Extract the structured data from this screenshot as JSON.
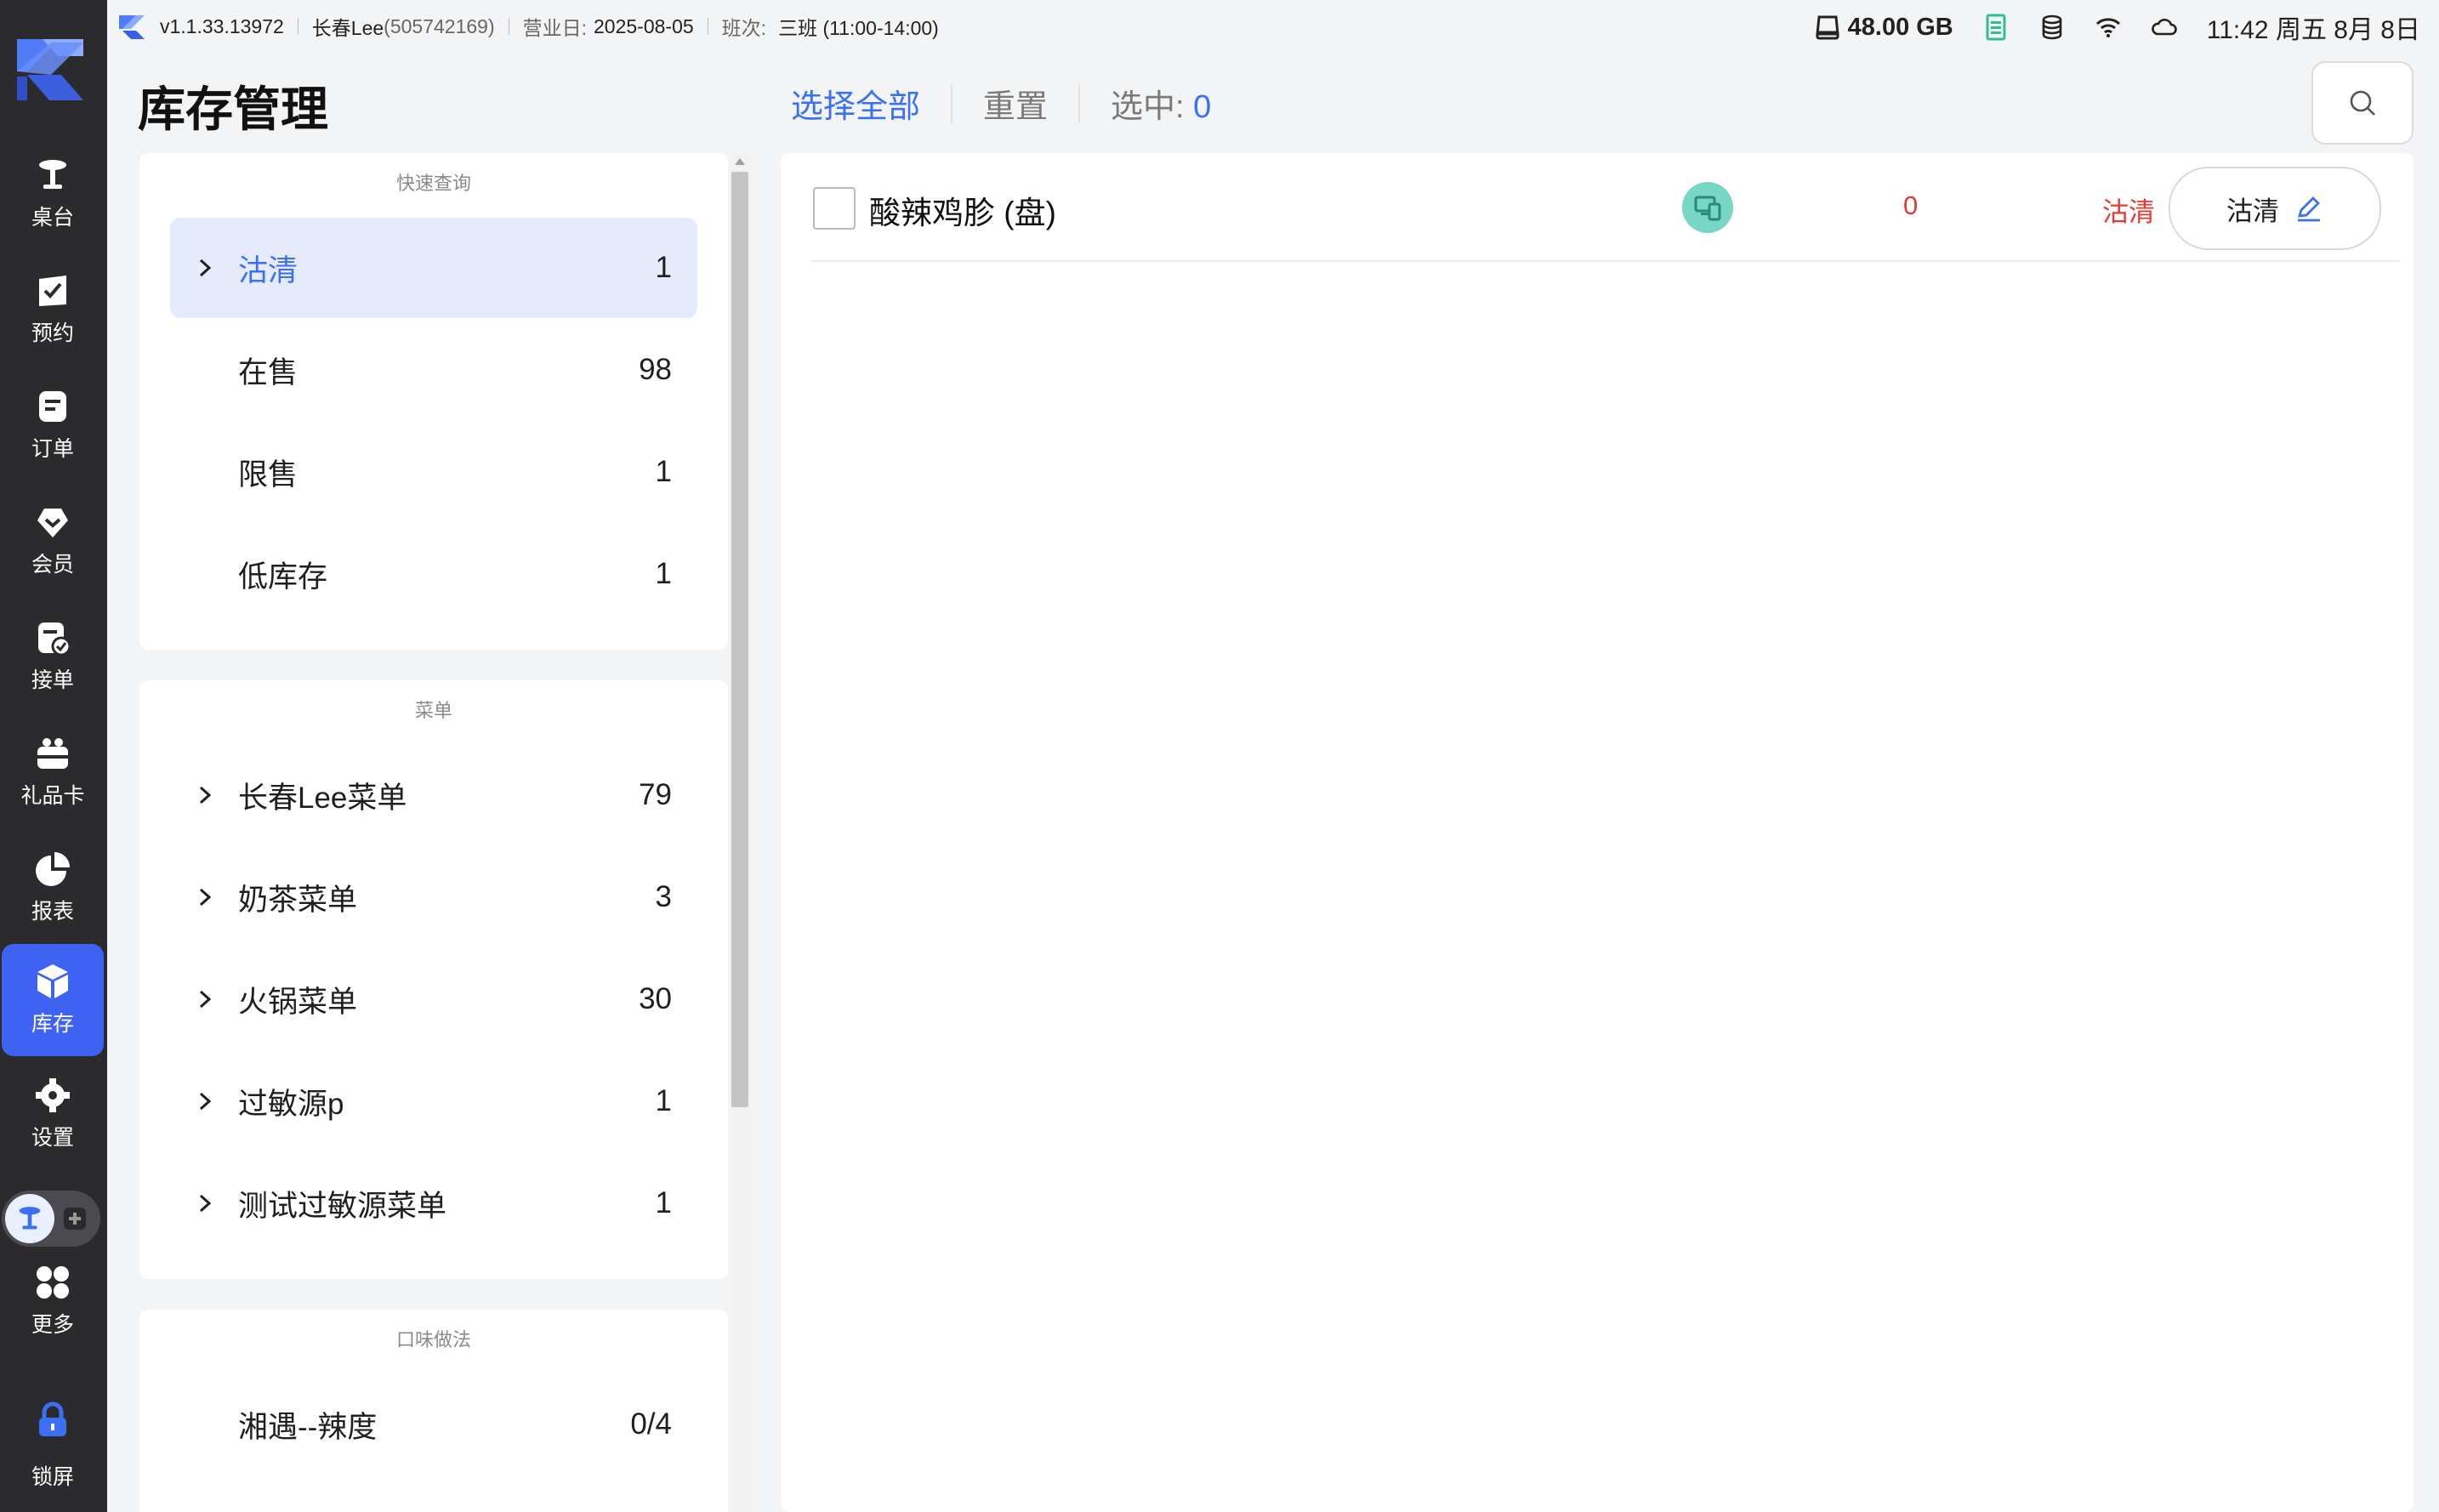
{
  "app": {
    "version": "v1.1.33.13972",
    "store": "长春Lee",
    "store_id": "(505742169)",
    "business_day_label": "营业日:",
    "business_day": "2025-08-05",
    "shift_label": "班次:",
    "shift": "三班 (11:00-14:00)"
  },
  "status": {
    "disk": "48.00 GB",
    "time": "11:42 周五 8月 8日"
  },
  "nav": {
    "items": [
      {
        "label": "桌台",
        "icon": "table-icon"
      },
      {
        "label": "预约",
        "icon": "reservation-icon"
      },
      {
        "label": "订单",
        "icon": "order-icon"
      },
      {
        "label": "会员",
        "icon": "member-icon"
      },
      {
        "label": "接单",
        "icon": "accept-order-icon"
      },
      {
        "label": "礼品卡",
        "icon": "gift-card-icon"
      },
      {
        "label": "报表",
        "icon": "report-icon"
      },
      {
        "label": "库存",
        "icon": "inventory-icon"
      },
      {
        "label": "设置",
        "icon": "settings-icon"
      },
      {
        "label": "更多",
        "icon": "more-icon"
      },
      {
        "label": "锁屏",
        "icon": "lock-icon"
      }
    ],
    "active": "库存"
  },
  "header": {
    "title": "库存管理",
    "select_all": "选择全部",
    "reset": "重置",
    "selected_label": "选中:",
    "selected_count": "0"
  },
  "filters": {
    "quick": {
      "title": "快速查询",
      "items": [
        {
          "label": "沽清",
          "count": "1"
        },
        {
          "label": "在售",
          "count": "98"
        },
        {
          "label": "限售",
          "count": "1"
        },
        {
          "label": "低库存",
          "count": "1"
        }
      ]
    },
    "menu": {
      "title": "菜单",
      "items": [
        {
          "label": "长春Lee菜单",
          "count": "79"
        },
        {
          "label": "奶茶菜单",
          "count": "3"
        },
        {
          "label": "火锅菜单",
          "count": "30"
        },
        {
          "label": "过敏源p",
          "count": "1"
        },
        {
          "label": "测试过敏源菜单",
          "count": "1"
        }
      ]
    },
    "flavor": {
      "title": "口味做法",
      "items": [
        {
          "label": "湘遇--辣度",
          "count": "0/4"
        }
      ]
    }
  },
  "items": [
    {
      "name": "酸辣鸡胗 (盘)",
      "quantity": "0",
      "status": "沽清",
      "action_label": "沽清"
    }
  ],
  "colors": {
    "accent": "#3b6ff5",
    "danger": "#e53935",
    "nav_bg": "#2b2b2e",
    "badge": "#78d6c4"
  }
}
